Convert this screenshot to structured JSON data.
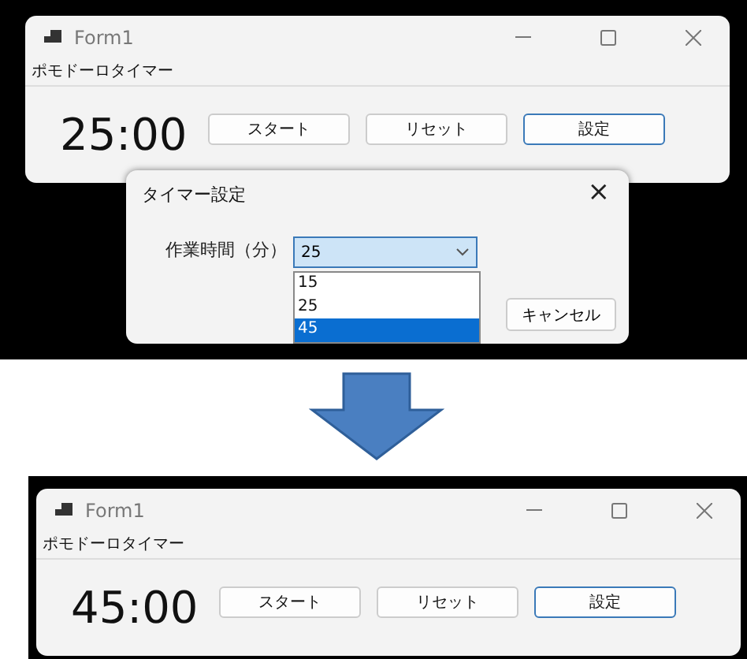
{
  "windows": [
    {
      "title": "Form1",
      "menu_label": "ポモドーロタイマー",
      "time": "25:00",
      "buttons": [
        {
          "label": "スタート",
          "focused": false
        },
        {
          "label": "リセット",
          "focused": false
        },
        {
          "label": "設定",
          "focused": true
        }
      ]
    },
    {
      "title": "Form1",
      "menu_label": "ポモドーロタイマー",
      "time": "45:00",
      "buttons": [
        {
          "label": "スタート",
          "focused": false
        },
        {
          "label": "リセット",
          "focused": false
        },
        {
          "label": "設定",
          "focused": true
        }
      ]
    }
  ],
  "dialog": {
    "title": "タイマー設定",
    "close": "×",
    "field_label": "作業時間（分）",
    "value": "25",
    "options": [
      {
        "label": "15",
        "highlighted": false
      },
      {
        "label": "25",
        "highlighted": false
      },
      {
        "label": "45",
        "highlighted": true
      }
    ],
    "buttons": [
      "キャンセル"
    ]
  }
}
